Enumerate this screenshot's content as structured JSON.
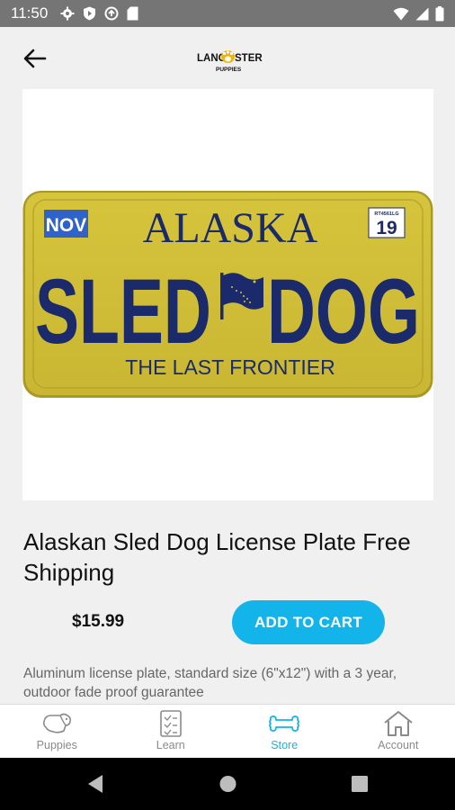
{
  "status_bar": {
    "time": "11:50"
  },
  "product": {
    "plate": {
      "state": "ALASKA",
      "month": "NOV",
      "sticker_label": "RT4561LG",
      "year": "19",
      "word_left": "SLED",
      "word_right": "DOG",
      "slogan": "THE LAST FRONTIER",
      "plate_color": "#d9c63a",
      "text_color": "#1a2a6b"
    },
    "title": "Alaskan Sled Dog License Plate Free Shipping",
    "price": "$15.99",
    "add_to_cart_label": "ADD TO CART",
    "description": "Aluminum license plate, standard size (6\"x12\") with a 3 year, outdoor fade proof guarantee"
  },
  "bottom_nav": {
    "items": [
      {
        "label": "Puppies",
        "icon": "puppies-icon",
        "active": false
      },
      {
        "label": "Learn",
        "icon": "learn-icon",
        "active": false
      },
      {
        "label": "Store",
        "icon": "bone-icon",
        "active": true
      },
      {
        "label": "Account",
        "icon": "home-icon",
        "active": false
      }
    ]
  },
  "colors": {
    "accent": "#12b4ea",
    "status_bar": "#757575"
  }
}
